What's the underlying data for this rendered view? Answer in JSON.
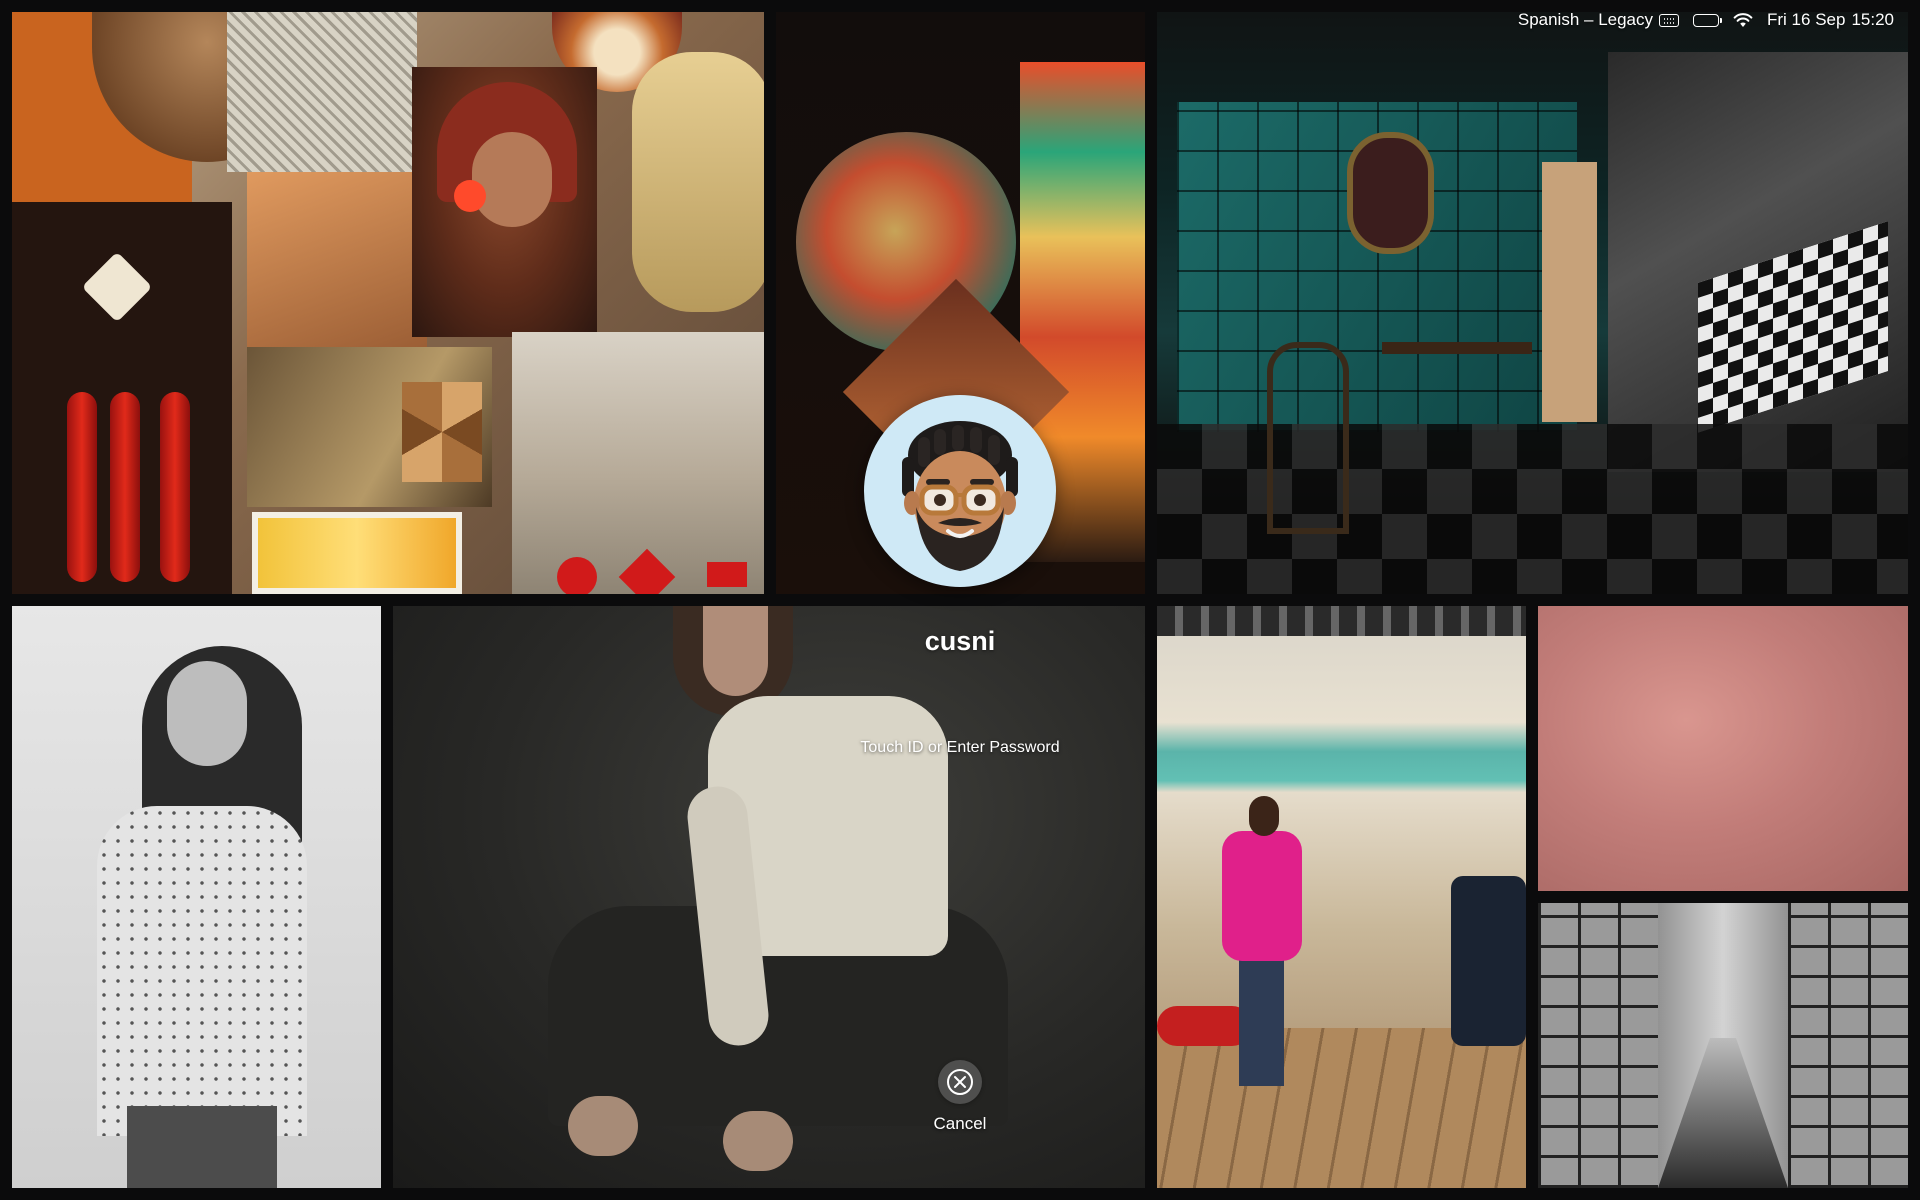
{
  "menubar": {
    "input_source": "Spanish – Legacy",
    "date": "Fri 16 Sep",
    "time": "15:20",
    "icons": [
      "keyboard-icon",
      "battery-icon",
      "wifi-icon"
    ]
  },
  "login": {
    "username": "cusni",
    "prompt": "Touch ID or Enter Password",
    "cancel_label": "Cancel",
    "avatar_icon": "memoji-avatar"
  },
  "wallpaper": {
    "tiles": [
      "collage",
      "projection-portrait",
      "teal-room",
      "bw-portrait",
      "dancer",
      "pink-coat-room",
      "skin-macro",
      "corridor"
    ]
  },
  "colors": {
    "background": "#0b0b0c",
    "text": "#ffffff",
    "avatar_bg": "#cfe9f6"
  }
}
